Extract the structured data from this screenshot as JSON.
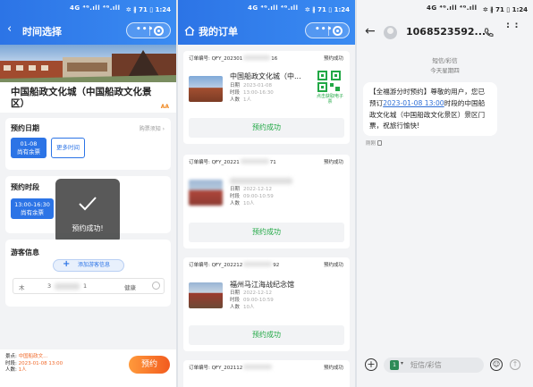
{
  "status_bar": {
    "signal": "4G ⁴ᴳ.ıll ⁴ᴳ.ıll",
    "right": "✲ ∦ 71 ▯ 1:24"
  },
  "screen1": {
    "nav": {
      "title": "时间选择",
      "capsule_dots": "•••"
    },
    "venue_title": "中国船政文化城（中国船政文化景区）",
    "venue_badge": "AA",
    "date_section": {
      "title": "预约日期",
      "hint": "购票须知 ›",
      "selected_date": "01-08",
      "selected_status": "尚有余票",
      "more_button": "更多时间"
    },
    "time_section": {
      "title": "预约时段",
      "selected_time": "13:00-16:30",
      "selected_status": "尚有余票"
    },
    "toast": {
      "text": "预约成功!"
    },
    "visitor_section": {
      "title": "游客信息",
      "add_button": "添加游客信息",
      "name_prefix": "木",
      "id_mid": "3",
      "id_end": "1",
      "health": "健康"
    },
    "footer": {
      "venue_label": "景点:",
      "venue_value": "中国船政文...",
      "time_label": "时段:",
      "time_value": "2023-01-08 13:00",
      "people_label": "人数:",
      "people_value": "1人",
      "book_button": "预约"
    }
  },
  "screen2": {
    "nav": {
      "title": "我的订单",
      "capsule_dots": "•••"
    },
    "orders": [
      {
        "no": "订单编号: QFY_202301",
        "no_end": "16",
        "status": "预约成功",
        "name": "中国船政文化城（中...",
        "date_label": "日期",
        "date": "2023-01-08",
        "time_label": "时段",
        "time": "13:00-16:30",
        "people_label": "人数",
        "people": "1人",
        "qr_hint": "点击获取电子票",
        "button": "预约成功"
      },
      {
        "no": "订单编号: QFY_20221",
        "no_end": "71",
        "status": "预约成功",
        "name": "",
        "date_label": "日期",
        "date": "2022-12-12",
        "time_label": "时段",
        "time": "09:00-10:59",
        "people_label": "人数",
        "people": "10人",
        "button": "预约成功"
      },
      {
        "no": "订单编号: QFY_202212",
        "no_end": "92",
        "status": "预约成功",
        "name": "福州马江海战纪念馆",
        "date_label": "日期",
        "date": "2022-12-12",
        "time_label": "时段",
        "time": "09:00-10:59",
        "people_label": "人数",
        "people": "10人",
        "button": "预约成功"
      },
      {
        "no": "订单编号: QFY_202112",
        "no_end": "",
        "status": "预约成功"
      }
    ]
  },
  "screen3": {
    "sender": "1068523592...",
    "channel": "短信/彩信",
    "day": "今天星期四",
    "message_before": "【全福游分时预约】尊敬的用户，您已预订",
    "message_link": "2023-01-08 13:00",
    "message_after": "时段的中国船政文化城（中国船政文化景区）景区门票，祝旅行愉快!",
    "time": "刚刚",
    "input_placeholder": "短信/彩信",
    "sim_label": "1"
  }
}
